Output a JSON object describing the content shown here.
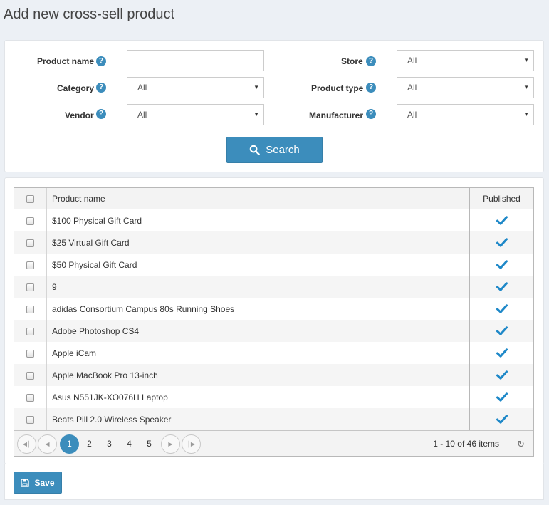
{
  "page": {
    "title": "Add new cross-sell product"
  },
  "search": {
    "product_name_label": "Product name",
    "product_name_value": "",
    "category_label": "Category",
    "category_value": "All",
    "vendor_label": "Vendor",
    "vendor_value": "All",
    "store_label": "Store",
    "store_value": "All",
    "product_type_label": "Product type",
    "product_type_value": "All",
    "manufacturer_label": "Manufacturer",
    "manufacturer_value": "All",
    "help_glyph": "?",
    "search_button": "Search",
    "search_icon": "search-icon"
  },
  "grid": {
    "columns": [
      "Product name",
      "Published"
    ],
    "rows": [
      {
        "name": "$100 Physical Gift Card",
        "published": true
      },
      {
        "name": "$25 Virtual Gift Card",
        "published": true
      },
      {
        "name": "$50 Physical Gift Card",
        "published": true
      },
      {
        "name": "9",
        "published": true
      },
      {
        "name": "adidas Consortium Campus 80s Running Shoes",
        "published": true
      },
      {
        "name": "Adobe Photoshop CS4",
        "published": true
      },
      {
        "name": "Apple iCam",
        "published": true
      },
      {
        "name": "Apple MacBook Pro 13-inch",
        "published": true
      },
      {
        "name": "Asus N551JK-XO076H Laptop",
        "published": true
      },
      {
        "name": "Beats Pill 2.0 Wireless Speaker",
        "published": true
      }
    ]
  },
  "pager": {
    "pages": [
      "1",
      "2",
      "3",
      "4",
      "5"
    ],
    "current_page": "1",
    "info": "1 - 10 of 46 items"
  },
  "footer": {
    "save_button": "Save"
  },
  "colors": {
    "accent": "#3c8dbc",
    "check": "#1e88c8",
    "background": "#ecf0f5"
  }
}
